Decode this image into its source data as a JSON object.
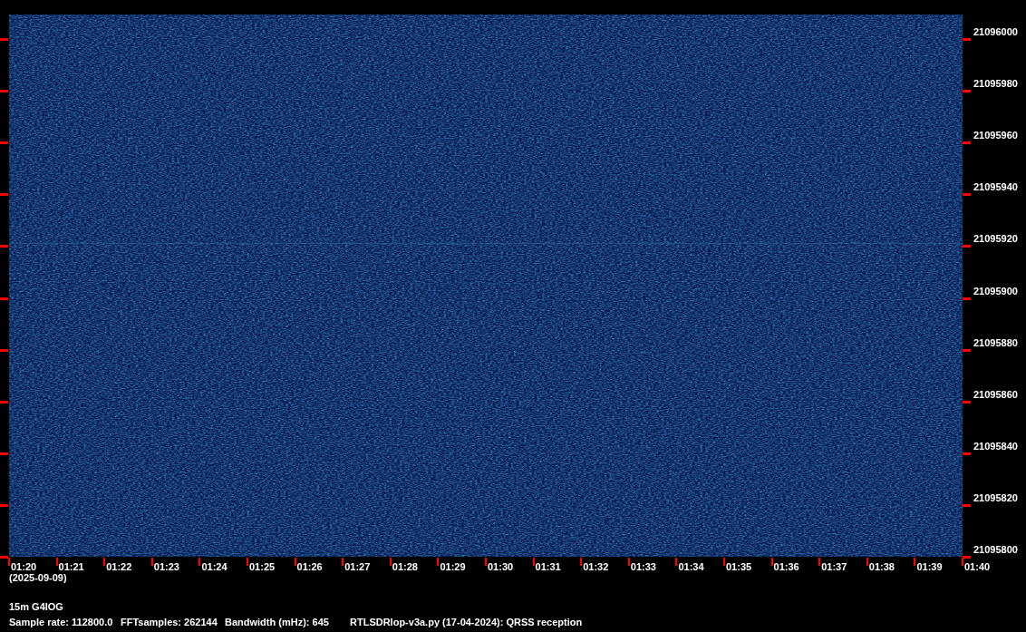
{
  "waterfall": {
    "frequency_labels": [
      "21096000",
      "21095980",
      "21095960",
      "21095940",
      "21095920",
      "21095900",
      "21095880",
      "21095860",
      "21095840",
      "21095820",
      "21095800"
    ],
    "time_labels": [
      "01:20",
      "01:21",
      "01:22",
      "01:23",
      "01:24",
      "01:25",
      "01:26",
      "01:27",
      "01:28",
      "01:29",
      "01:30",
      "01:31",
      "01:32",
      "01:33",
      "01:34",
      "01:35",
      "01:36",
      "01:37",
      "01:38",
      "01:39",
      "01:40"
    ],
    "date": "(2025-09-09)"
  },
  "footer": {
    "title": "15m G4IOG",
    "params": [
      "Sample rate: 112800.0",
      "FFTsamples: 262144",
      "Bandwidth (mHz): 645",
      "RTLSDRlop-v3a.py (17-04-2024): QRSS reception"
    ]
  }
}
